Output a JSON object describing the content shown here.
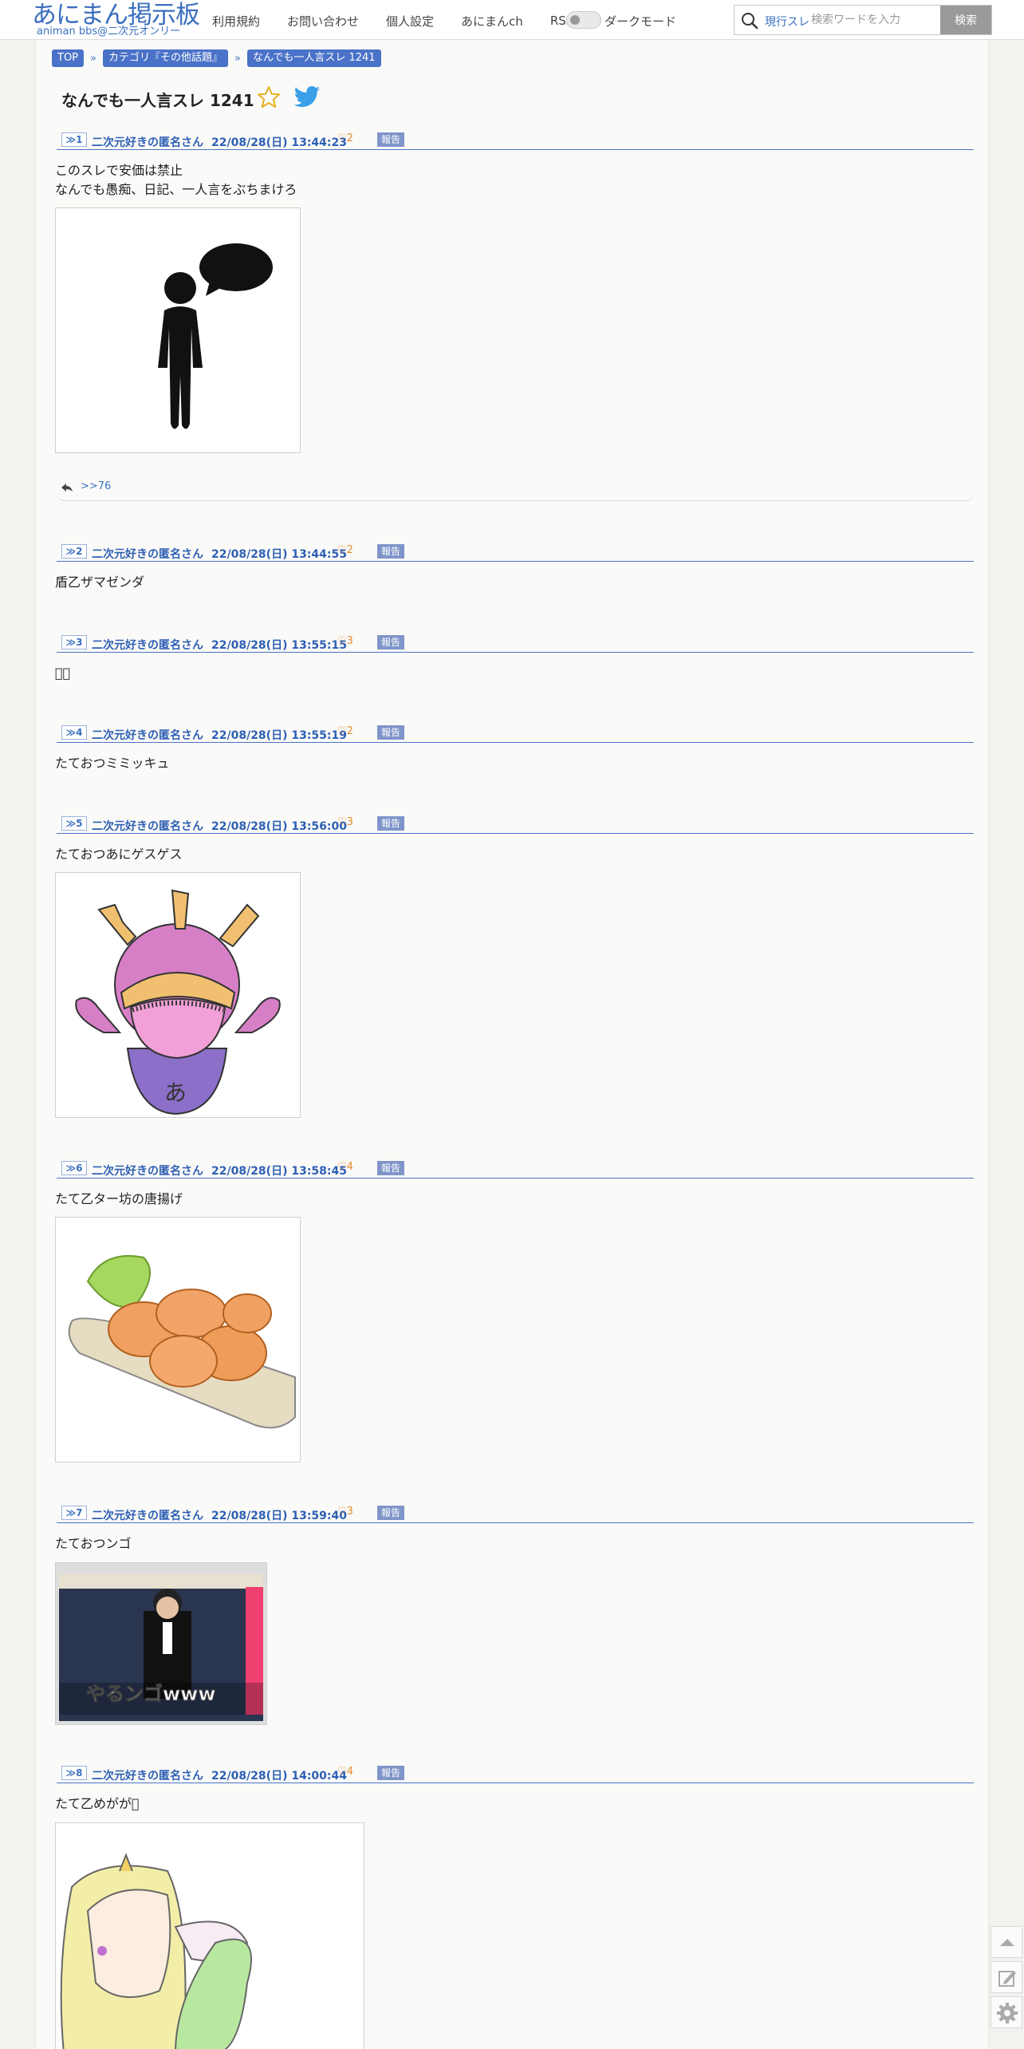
{
  "site": {
    "logo_main": "あにまん掲示板",
    "logo_sub": "animan bbs@二次元オンリー"
  },
  "nav": {
    "items": [
      "利用規約",
      "お問い合わせ",
      "個人設定",
      "あにまんch",
      "RSS"
    ],
    "dark_mode_label": "ダークモード",
    "dark_mode_on": false
  },
  "search": {
    "scope": "現行スレ",
    "placeholder": "検索ワードを入力",
    "button": "検索"
  },
  "breadcrumb": [
    "TOP",
    "カテゴリ『その他話題』",
    "なんでも一人言スレ 1241"
  ],
  "thread": {
    "title": "なんでも一人言スレ 1241"
  },
  "posts": [
    {
      "num": "≫1",
      "name": "二次元好きの匿名さん",
      "date": "22/08/28(日) 13:44:23",
      "likes": "2",
      "report": "報告",
      "body": "このスレで安価は禁止\nなんでも愚痴、日記、一人言をぶちまけろ",
      "image": "speech-person"
    },
    {
      "num": "≫2",
      "name": "二次元好きの匿名さん",
      "date": "22/08/28(日) 13:44:55",
      "likes": "2",
      "report": "報告",
      "body": "盾乙ザマゼンダ"
    },
    {
      "num": "≫3",
      "name": "二次元好きの匿名さん",
      "date": "22/08/28(日) 13:55:15",
      "likes": "3",
      "report": "報告",
      "body": "􀀀􀀀"
    },
    {
      "num": "≫4",
      "name": "二次元好きの匿名さん",
      "date": "22/08/28(日) 13:55:19",
      "likes": "2",
      "report": "報告",
      "body": "たておつミミッキュ"
    },
    {
      "num": "≫5",
      "name": "二次元好きの匿名さん",
      "date": "22/08/28(日) 13:56:00",
      "likes": "3",
      "report": "報告",
      "body": "たておつあにゲスゲス",
      "image": "monster"
    },
    {
      "num": "≫6",
      "name": "二次元好きの匿名さん",
      "date": "22/08/28(日) 13:58:45",
      "likes": "4",
      "report": "報告",
      "body": "たて乙ター坊の唐揚げ",
      "image": "karaage"
    },
    {
      "num": "≫7",
      "name": "二次元好きの匿名さん",
      "date": "22/08/28(日) 13:59:40",
      "likes": "3",
      "report": "報告",
      "body": "たておつンゴ",
      "image": "tv",
      "image_caption": "やるンゴwww"
    },
    {
      "num": "≫8",
      "name": "二次元好きの匿名さん",
      "date": "22/08/28(日) 14:00:44",
      "likes": "4",
      "report": "報告",
      "body": "たて乙めがが􀀀",
      "image": "girl"
    }
  ],
  "reply_link": ">>76"
}
